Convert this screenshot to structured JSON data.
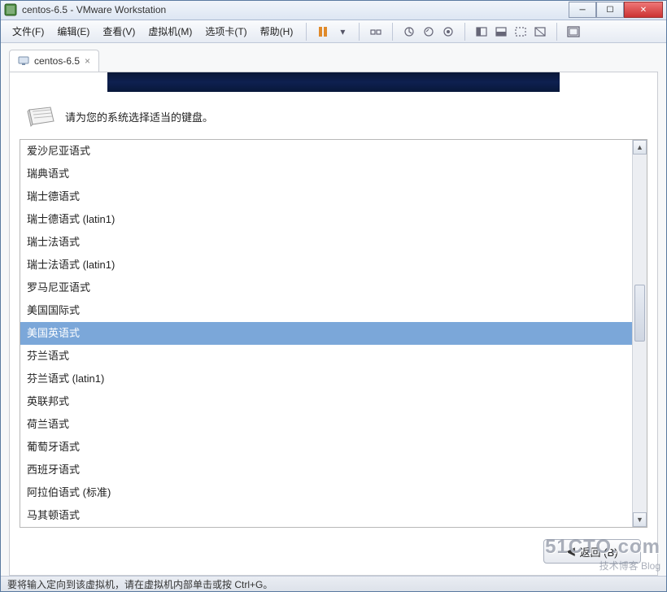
{
  "window": {
    "title": "centos-6.5 - VMware Workstation"
  },
  "menus": {
    "file": "文件(F)",
    "edit": "编辑(E)",
    "view": "查看(V)",
    "vm": "虚拟机(M)",
    "tabs": "选项卡(T)",
    "help": "帮助(H)"
  },
  "tab": {
    "label": "centos-6.5"
  },
  "prompt": {
    "text": "请为您的系统选择适当的键盘。"
  },
  "keyboard_list": [
    "爱沙尼亚语式",
    "瑞典语式",
    "瑞士德语式",
    "瑞士德语式 (latin1)",
    "瑞士法语式",
    "瑞士法语式 (latin1)",
    "罗马尼亚语式",
    "美国国际式",
    "美国英语式",
    "芬兰语式",
    "芬兰语式 (latin1)",
    "英联邦式",
    "荷兰语式",
    "葡萄牙语式",
    "西班牙语式",
    "阿拉伯语式 (标准)",
    "马其顿语式"
  ],
  "selected_index": 8,
  "buttons": {
    "back": "返回 (B)"
  },
  "statusbar": {
    "text": "要将输入定向到该虚拟机，请在虚拟机内部单击或按 Ctrl+G。"
  },
  "watermark": {
    "line1": "51CTO.com",
    "line2": "技术博客",
    "tag": "Blog"
  }
}
